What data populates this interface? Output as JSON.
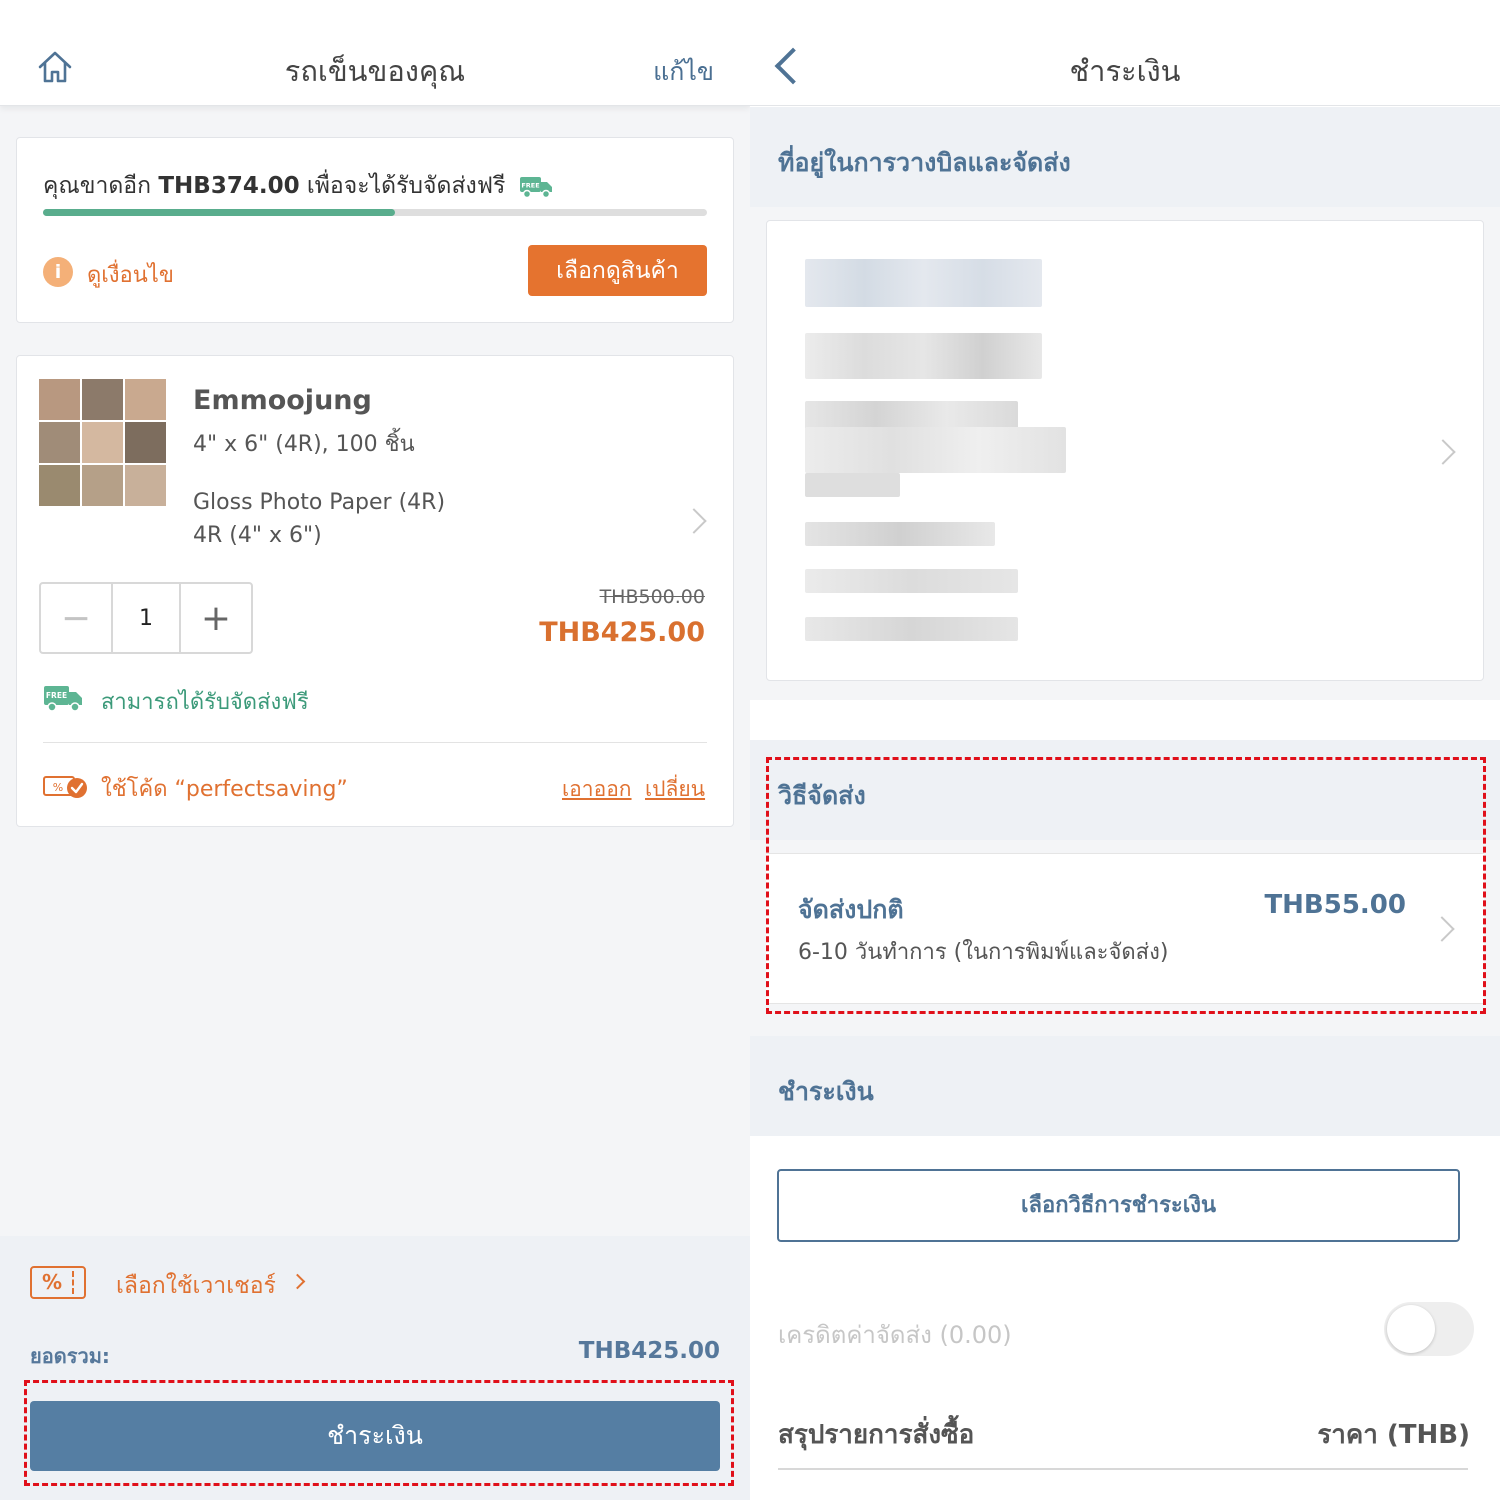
{
  "cart": {
    "title": "รถเข็นของคุณ",
    "edit_label": "แก้ไข",
    "free_shipping": {
      "message_prefix": "คุณขาดอีก",
      "remaining_amount": "THB374.00",
      "message_suffix": "เพื่อจะได้รับจัดส่งฟรี",
      "badge_text": "FREE",
      "progress_fraction": 0.53,
      "conditions_label": "ดูเงื่อนไข",
      "browse_button": "เลือกดูสินค้า"
    },
    "item": {
      "name": "Emmoojung",
      "size": "4\" x 6\" (4R), 100 ชิ้น",
      "paper": "Gloss Photo Paper (4R)",
      "dimension": "4R (4\" x 6\")",
      "quantity": "1",
      "minus_label": "−",
      "plus_label": "+",
      "original_price": "THB500.00",
      "price": "THB425.00",
      "free_shipping_text": "สามารถได้รับจัดส่งฟรี",
      "free_badge_text": "FREE",
      "coupon_text": "ใช้โค้ด “perfectsaving”",
      "remove_label": "เอาออก",
      "change_label": "เปลี่ยน"
    },
    "footer": {
      "voucher_icon_text": "%",
      "voucher_label": "เลือกใช้เวาเชอร์",
      "total_label": "ยอดรวม:",
      "total_value": "THB425.00",
      "checkout_button": "ชำระเงิน"
    }
  },
  "checkout": {
    "title": "ชำระเงิน",
    "address_section_title": "ที่อยู่ในการวางบิลและจัดส่ง",
    "shipping_section_title": "วิธีจัดส่ง",
    "shipping_method": {
      "name": "จัดส่งปกติ",
      "price": "THB55.00",
      "detail": "6-10 วันทำการ (ในการพิมพ์และจัดส่ง)"
    },
    "payment_section_title": "ชำระเงิน",
    "payment_button": "เลือกวิธีการชำระเงิน",
    "credit_label": "เครดิตค่าจัดส่ง (0.00)",
    "credit_toggle_on": false,
    "summary_title": "สรุปรายการสั่งซื้อ",
    "summary_price_header": "ราคา (THB)"
  },
  "colors": {
    "accent_orange": "#e5732f",
    "accent_blue": "#557ea3",
    "accent_green": "#59ad8d",
    "highlight_red": "#e0101a"
  }
}
